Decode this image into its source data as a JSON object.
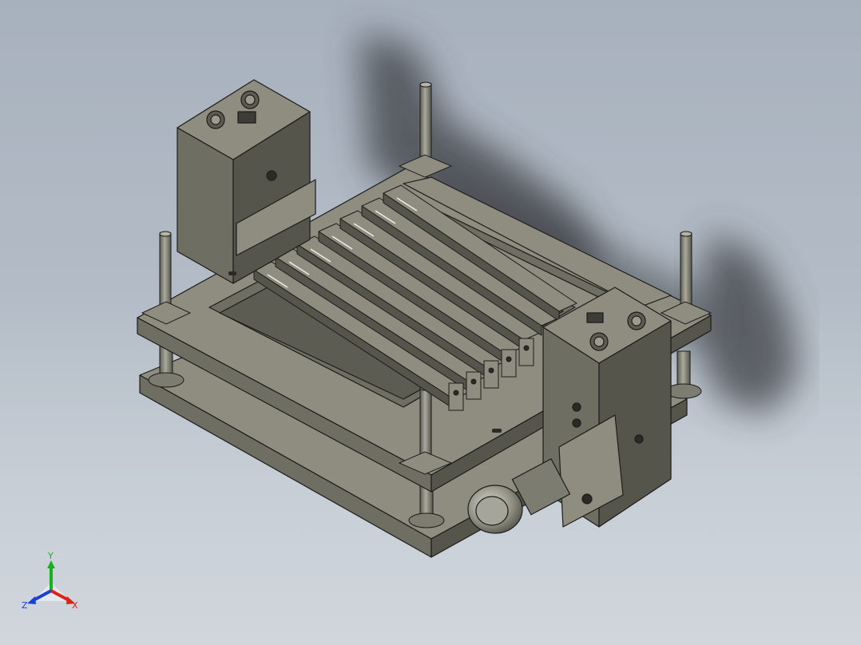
{
  "triad": {
    "x_label": "X",
    "y_label": "Y",
    "z_label": "Z",
    "x_color": "#e0201a",
    "y_color": "#18b020",
    "z_color": "#1a40d8"
  },
  "colors": {
    "background_top": "#a7b1bd",
    "background_bottom": "#d1d6dc",
    "steel_top": "#8e8d80",
    "steel_side": "#6f6e63",
    "steel_dark": "#55554c",
    "edge": "#1c1c1a",
    "shadow": "#3c3f45"
  },
  "icons": [
    "view-orientation-triad-icon"
  ]
}
